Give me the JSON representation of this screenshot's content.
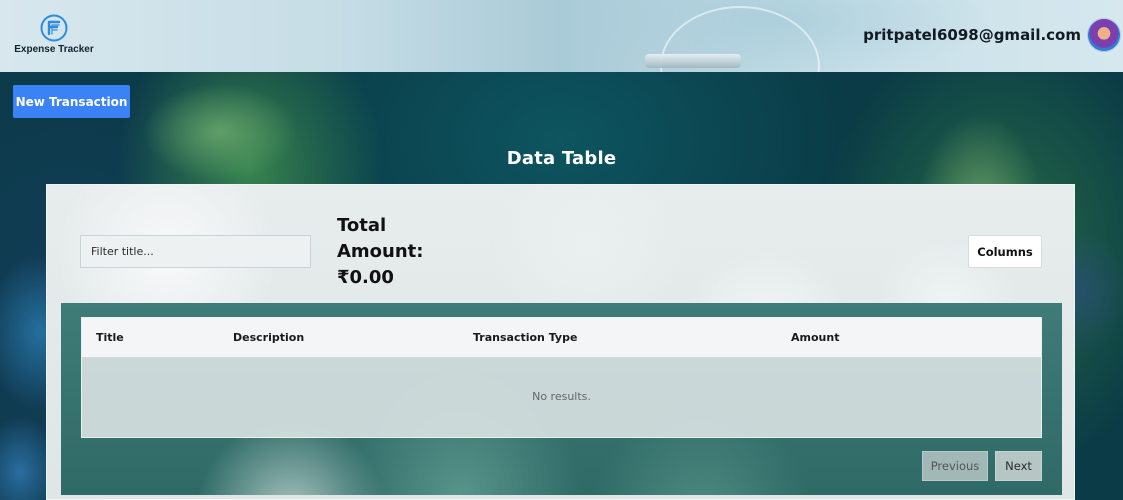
{
  "header": {
    "brand_name": "Expense Tracker",
    "user_email": "pritpatel6098@gmail.com"
  },
  "toolbar": {
    "new_transaction_label": "New Transaction"
  },
  "page": {
    "title": "Data Table"
  },
  "filters": {
    "title_placeholder": "Filter title...",
    "title_value": ""
  },
  "summary": {
    "total_label": "Total Amount:",
    "total_value": "₹0.00"
  },
  "columns_button_label": "Columns",
  "table": {
    "headers": [
      "Title",
      "Description",
      "Transaction Type",
      "Amount"
    ],
    "rows": [],
    "empty_message": "No results."
  },
  "pagination": {
    "previous_label": "Previous",
    "next_label": "Next"
  },
  "colors": {
    "accent": "#3b82f6"
  },
  "icons": {
    "brand": "expense-tracker-logo",
    "avatar": "user-avatar"
  }
}
